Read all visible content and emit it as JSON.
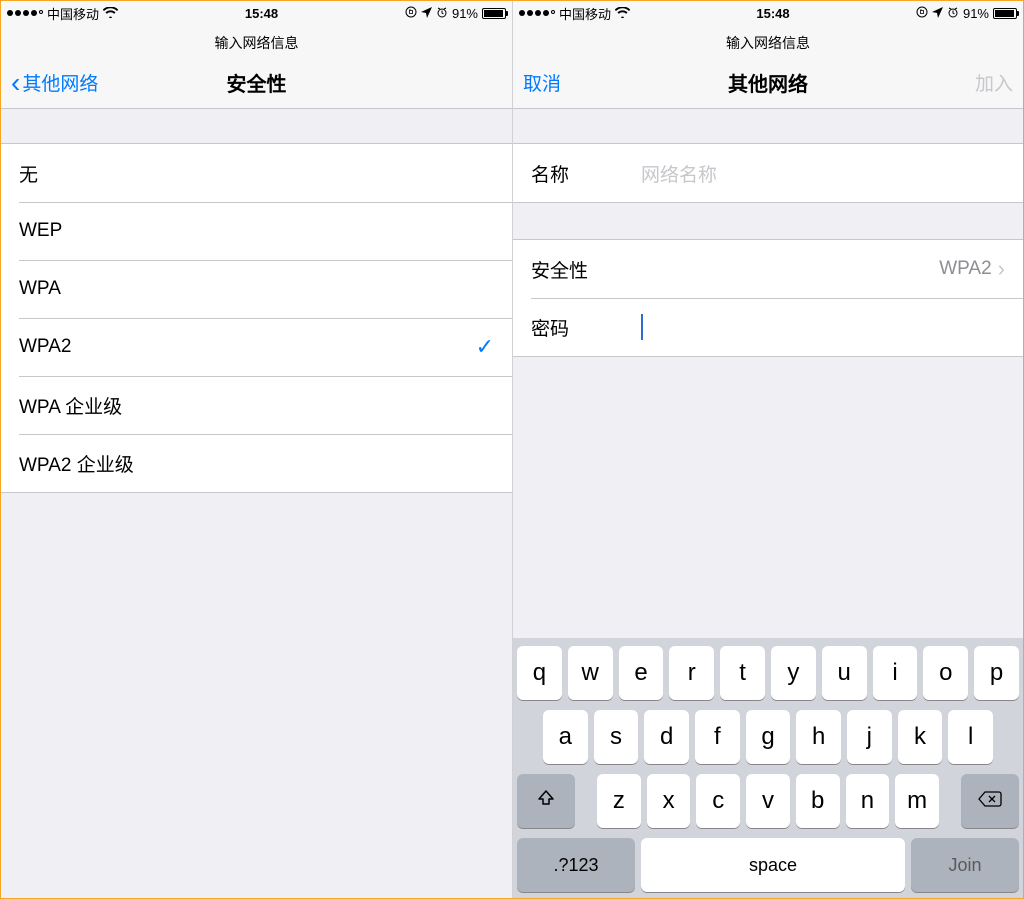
{
  "statusbar": {
    "carrier": "中国移动",
    "time": "15:48",
    "battery_pct": "91%"
  },
  "left_screen": {
    "subnav": "输入网络信息",
    "back_label": "其他网络",
    "title": "安全性",
    "options": {
      "none": "无",
      "wep": "WEP",
      "wpa": "WPA",
      "wpa2": "WPA2",
      "wpa_ent": "WPA 企业级",
      "wpa2_ent": "WPA2 企业级"
    }
  },
  "right_screen": {
    "subnav": "输入网络信息",
    "cancel": "取消",
    "title": "其他网络",
    "join": "加入",
    "name_label": "名称",
    "name_placeholder": "网络名称",
    "security_label": "安全性",
    "security_value": "WPA2",
    "password_label": "密码"
  },
  "keyboard": {
    "row1": [
      "q",
      "w",
      "e",
      "r",
      "t",
      "y",
      "u",
      "i",
      "o",
      "p"
    ],
    "row2": [
      "a",
      "s",
      "d",
      "f",
      "g",
      "h",
      "j",
      "k",
      "l"
    ],
    "row3": [
      "z",
      "x",
      "c",
      "v",
      "b",
      "n",
      "m"
    ],
    "numkey": ".?123",
    "space": "space",
    "join": "Join"
  }
}
